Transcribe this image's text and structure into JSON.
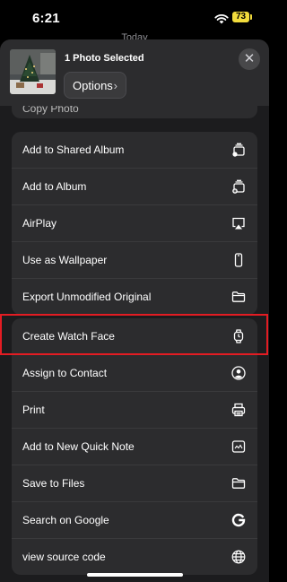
{
  "status_bar": {
    "time": "6:21",
    "battery": "73"
  },
  "background": {
    "title": "Today"
  },
  "header": {
    "title": "1 Photo Selected",
    "options_label": "Options",
    "options_chevron": "›",
    "close_glyph": "✕"
  },
  "partial_row_label": "Copy Photo",
  "group1": {
    "items": [
      {
        "label": "Add to Shared Album",
        "icon": "shared-album-icon"
      },
      {
        "label": "Add to Album",
        "icon": "add-album-icon"
      },
      {
        "label": "AirPlay",
        "icon": "airplay-icon"
      },
      {
        "label": "Use as Wallpaper",
        "icon": "phone-icon"
      },
      {
        "label": "Export Unmodified Original",
        "icon": "folder-icon"
      }
    ]
  },
  "group2": {
    "items": [
      {
        "label": "Create Watch Face",
        "icon": "watch-icon"
      },
      {
        "label": "Assign to Contact",
        "icon": "contact-icon"
      },
      {
        "label": "Print",
        "icon": "printer-icon"
      },
      {
        "label": "Add to New Quick Note",
        "icon": "quick-note-icon"
      },
      {
        "label": "Save to Files",
        "icon": "folder-icon"
      },
      {
        "label": "Search on Google",
        "icon": "google-icon"
      },
      {
        "label": "view source code",
        "icon": "globe-icon"
      }
    ]
  },
  "colors": {
    "highlight": "#e31c23",
    "sheet": "#1c1c1e",
    "row": "#2c2c2e"
  }
}
